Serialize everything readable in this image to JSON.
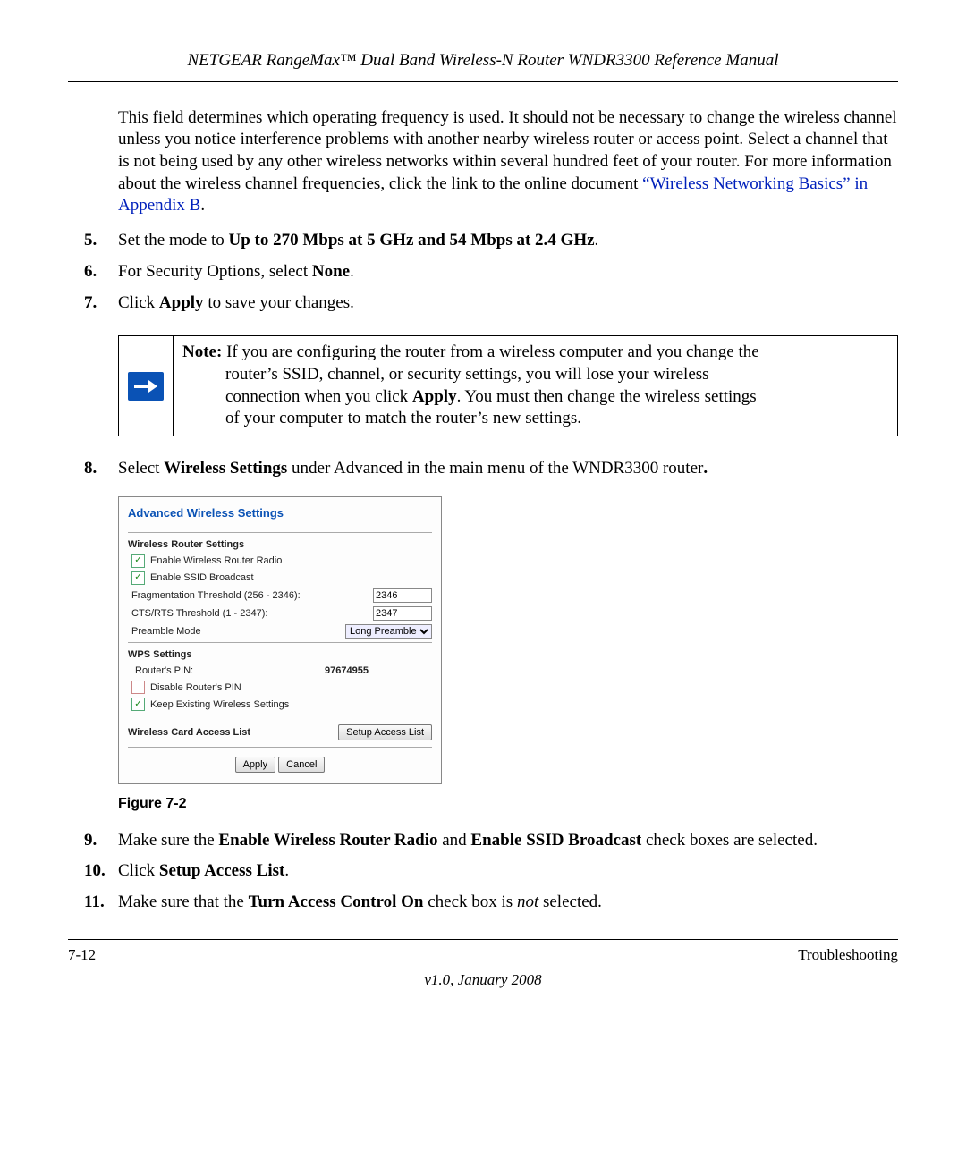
{
  "header": "NETGEAR RangeMax™ Dual Band Wireless-N Router WNDR3300 Reference Manual",
  "intro": "This field determines which operating frequency is used. It should not be necessary to change the wireless channel unless you notice interference problems with another nearby wireless router or access point. Select a channel that is not being used by any other wireless networks within several hundred feet of your router. For more information about the wireless channel frequencies, click the link to the online document ",
  "intro_link": "“Wireless Networking Basics” in Appendix B",
  "intro_period": ".",
  "steps": {
    "s5_num": "5.",
    "s5_a": "Set the mode to ",
    "s5_b": "Up to 270 Mbps at 5 GHz and 54 Mbps at 2.4 GHz",
    "s5_c": ".",
    "s6_num": "6.",
    "s6_a": "For Security Options, select ",
    "s6_b": "None",
    "s6_c": ".",
    "s7_num": "7.",
    "s7_a": "Click ",
    "s7_b": "Apply",
    "s7_c": " to save your changes.",
    "s8_num": "8.",
    "s8_a": "Select ",
    "s8_b": "Wireless Settings",
    "s8_c": " under Advanced in the main menu of the WNDR3300 router",
    "s8_d": ".",
    "s9_num": "9.",
    "s9_a": "Make sure the ",
    "s9_b": "Enable Wireless Router Radio",
    "s9_c": " and ",
    "s9_d": "Enable SSID Broadcast",
    "s9_e": " check boxes are selected.",
    "s10_num": "10.",
    "s10_a": "Click ",
    "s10_b": "Setup Access List",
    "s10_c": ".",
    "s11_num": "11.",
    "s11_a": "Make sure that the ",
    "s11_b": "Turn Access Control On",
    "s11_c": " check box is ",
    "s11_d": "not",
    "s11_e": " selected."
  },
  "note": {
    "label": "Note:",
    "l1": " If you are configuring the router from a wireless computer and you change the",
    "l2a": "router’s SSID, channel, or security settings, you will lose your wireless",
    "l2b": "connection when you click ",
    "l2c": "Apply",
    "l2d": ". You must then change the wireless settings",
    "l2e": "of your computer to match the router’s new settings."
  },
  "shot": {
    "title": "Advanced Wireless Settings",
    "sec1": "Wireless Router Settings",
    "chk1": "Enable Wireless Router Radio",
    "chk2": "Enable SSID Broadcast",
    "frag_label": "Fragmentation Threshold (256 - 2346):",
    "frag_val": "2346",
    "cts_label": "CTS/RTS Threshold (1 - 2347):",
    "cts_val": "2347",
    "preamble_label": "Preamble Mode",
    "preamble_val": "Long Preamble",
    "sec2": "WPS Settings",
    "pin_label": "Router's PIN:",
    "pin_val": "97674955",
    "chk3": "Disable Router's PIN",
    "chk4": "Keep Existing Wireless Settings",
    "sec3": "Wireless Card Access List",
    "setup_btn": "Setup Access List",
    "apply_btn": "Apply",
    "cancel_btn": "Cancel"
  },
  "figcap": "Figure 7-2",
  "footer": {
    "left": "7-12",
    "right": "Troubleshooting",
    "version": "v1.0, January 2008"
  }
}
